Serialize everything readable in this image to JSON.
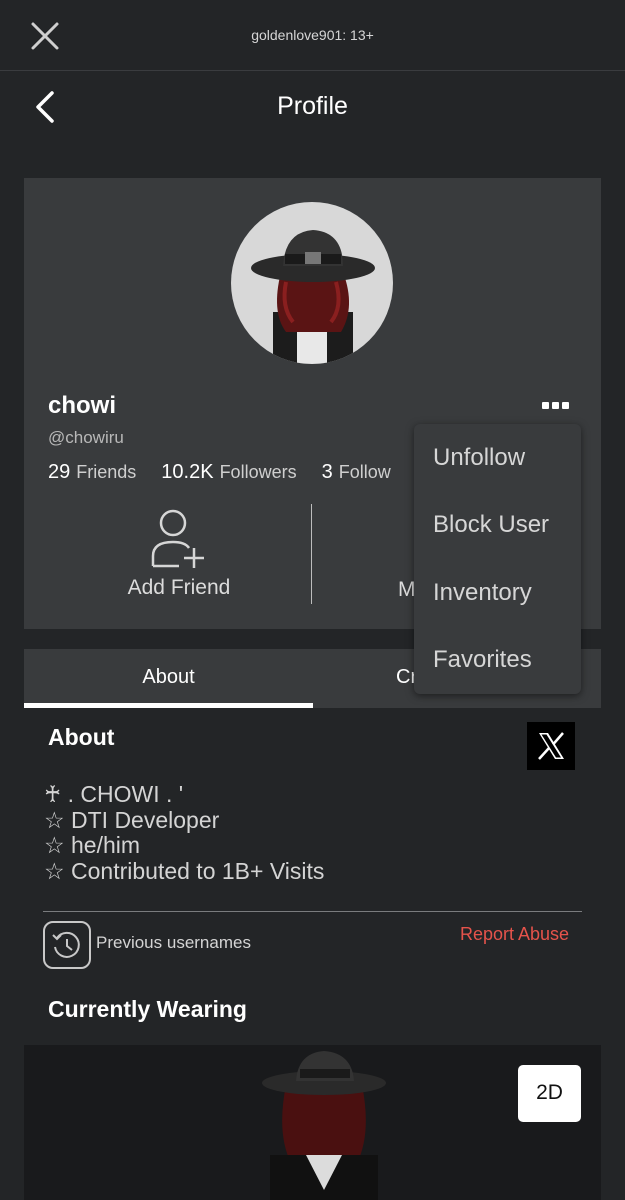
{
  "topbar": {
    "title": "goldenlove901: 13+"
  },
  "header": {
    "title": "Profile"
  },
  "profile": {
    "display_name": "chowi",
    "username": "@chowiru",
    "stats": [
      {
        "count": "29",
        "label": "Friends"
      },
      {
        "count": "10.2K",
        "label": "Followers"
      },
      {
        "count": "3",
        "label": "Follow"
      }
    ],
    "actions": {
      "add_friend": "Add Friend",
      "message_partial": "M"
    }
  },
  "menu": {
    "items": [
      "Unfollow",
      "Block User",
      "Inventory",
      "Favorites"
    ]
  },
  "tabs": {
    "about": "About",
    "creations_partial": "Cr"
  },
  "about": {
    "title": "About",
    "bio": [
      "♰ . CHOWI . '",
      "☆ DTI Developer",
      "☆ he/him",
      "☆ Contributed to 1B+ Visits"
    ],
    "previous_usernames": "Previous usernames",
    "report_abuse": "Report Abuse"
  },
  "wearing": {
    "title": "Currently Wearing",
    "toggle": "2D"
  },
  "colors": {
    "background": "#232527",
    "card": "#393b3d",
    "report": "#e5534b"
  },
  "icons": [
    "close-icon",
    "back-icon",
    "more-icon",
    "add-friend-icon",
    "x-logo-icon",
    "history-icon"
  ]
}
